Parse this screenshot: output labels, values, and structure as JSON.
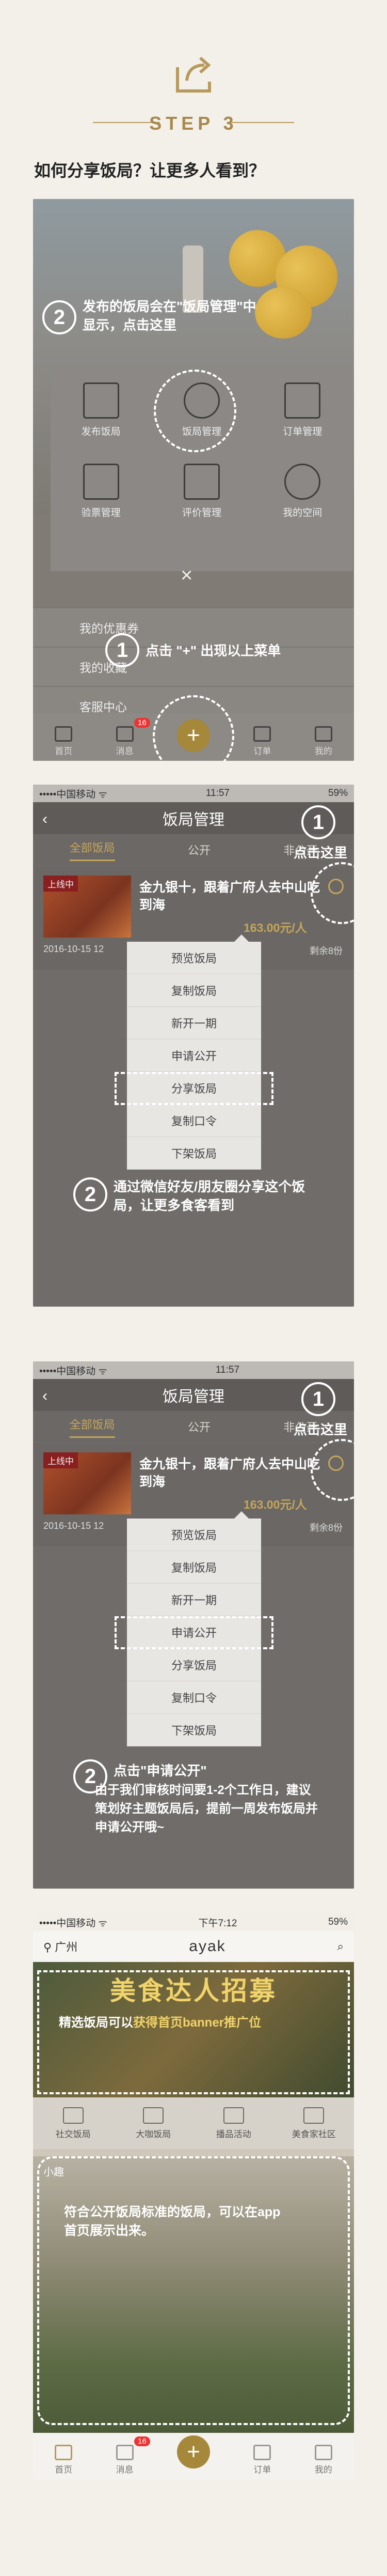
{
  "header": {
    "step_label": "STEP 3",
    "question": "如何分享饭局？让更多人看到？",
    "accent": "#b79a5c"
  },
  "screen1": {
    "note_step": "2",
    "note_text": "发布的饭局会在\"饭局管理\"中显示，点击这里",
    "grid": [
      {
        "label": "发布饭局",
        "icon": "publish-icon"
      },
      {
        "label": "饭局管理",
        "icon": "grid-manage-icon"
      },
      {
        "label": "订单管理",
        "icon": "order-icon"
      },
      {
        "label": "验票管理",
        "icon": "ticket-icon"
      },
      {
        "label": "评价管理",
        "icon": "review-icon"
      },
      {
        "label": "我的空间",
        "icon": "star-icon"
      }
    ],
    "close": "×",
    "rows": [
      "我的优惠券",
      "我的收藏",
      "客服中心"
    ],
    "tip_step": "1",
    "tip_text": "点击 \"+\" 出现以上菜单",
    "tabbar": [
      "首页",
      "消息",
      "订单",
      "我的"
    ],
    "badge": "16",
    "fab": "+"
  },
  "screen2": {
    "status_left": "•••••中国移动 ᯤ",
    "status_time": "11:57",
    "status_right": "59%",
    "title": "饭局管理",
    "back": "‹",
    "tabs": [
      "全部饭局",
      "公开",
      "非公开"
    ],
    "card_badge": "上线中",
    "card_title": "金九银十，跟着广府人去中山吃到海",
    "price": "163.00元/人",
    "card_date": "2016-10-15 12",
    "card_remain": "剩余8份",
    "menu": [
      "预览饭局",
      "复制饭局",
      "新开一期",
      "申请公开",
      "分享饭局",
      "复制口令",
      "下架饭局"
    ],
    "tap_step": "1",
    "tap_text": "点击这里",
    "note_step": "2",
    "note_text": "通过微信好友/朋友圈分享这个饭局，让更多食客看到"
  },
  "screen3": {
    "status_left": "•••••中国移动 ᯤ",
    "status_time": "11:57",
    "title": "饭局管理",
    "back": "‹",
    "tabs": [
      "全部饭局",
      "公开",
      "非公开"
    ],
    "card_badge": "上线中",
    "card_title": "金九银十，跟着广府人去中山吃到海",
    "price": "163.00元/人",
    "card_date": "2016-10-15 12",
    "card_remain": "剩余8份",
    "menu": [
      "预览饭局",
      "复制饭局",
      "新开一期",
      "申请公开",
      "分享饭局",
      "复制口令",
      "下架饭局"
    ],
    "tap_step": "1",
    "tap_text": "点击这里",
    "note_step": "2",
    "note_title": "点击\"申请公开\"",
    "note_text": "由于我们审核时间要1-2个工作日，建议策划好主题饭局后，提前一周发布饭局并申请公开哦~"
  },
  "screen4": {
    "status_left": "•••••中国移动 ᯤ",
    "status_time": "下午7:12",
    "status_right": "59%",
    "city": "广州",
    "logo": "ayak",
    "banner_text": "美食达人招募",
    "banner_note_pre": "精选饭局可以",
    "banner_note_em": "获得首页banner推广位",
    "cats": [
      "社交饭局",
      "大咖饭局",
      "播品活动",
      "美食家社区"
    ],
    "feed_tag": "小趣",
    "feed_note": "符合公开饭局标准的饭局，可以在app首页展示出来。",
    "tabbar": [
      "首页",
      "消息",
      "订单",
      "我的"
    ],
    "badge": "16",
    "fab": "+",
    "highlight": "#f0d36a"
  }
}
